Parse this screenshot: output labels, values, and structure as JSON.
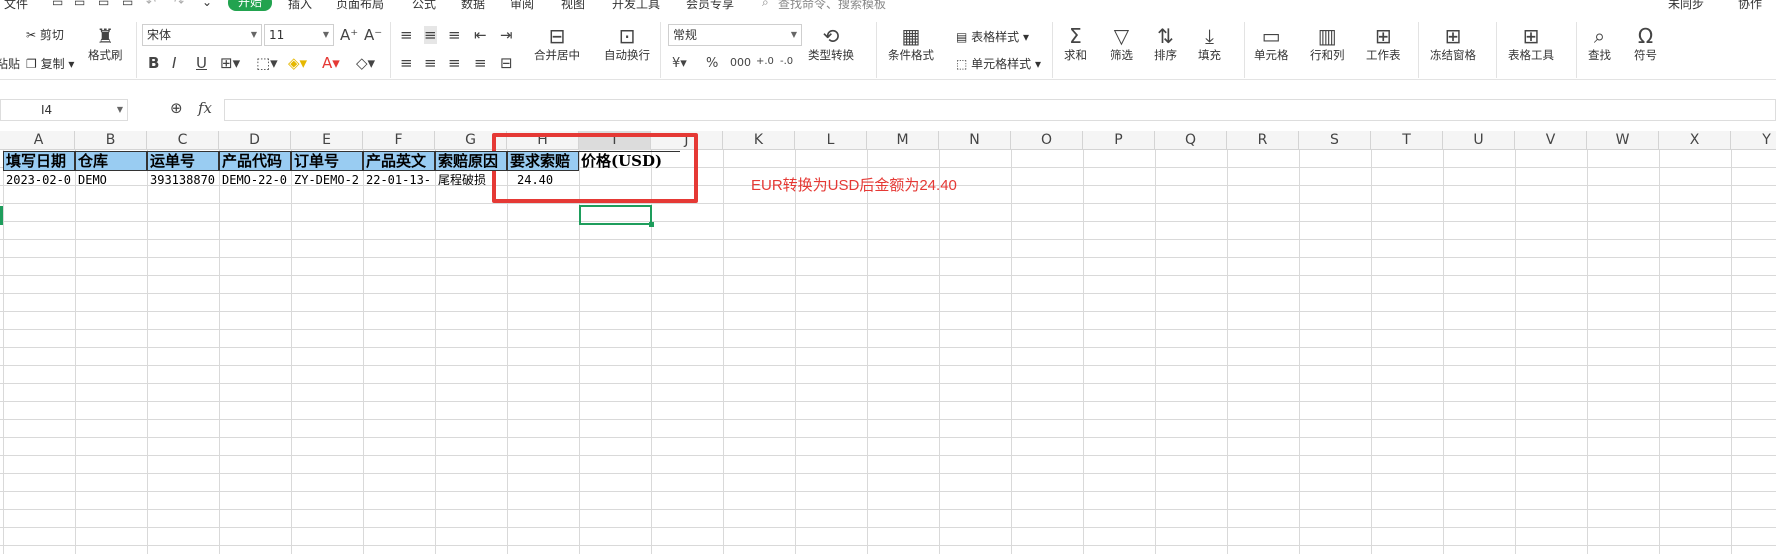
{
  "menubar": {
    "items": [
      "文件",
      "开始",
      "插入",
      "页面布局",
      "公式",
      "数据",
      "审阅",
      "视图",
      "开发工具",
      "会员专享"
    ],
    "search_placeholder": "查找命令、搜索模板",
    "right_items": [
      "未同步",
      "协作"
    ]
  },
  "ribbon": {
    "clipboard": {
      "cut": "剪切",
      "copy": "复制",
      "paste": "粘贴",
      "format_painter": "格式刷"
    },
    "font": {
      "name": "宋体",
      "size": "11"
    },
    "align": {
      "merge": "合并居中",
      "wrap": "自动换行"
    },
    "number": {
      "format": "常规",
      "convert": "类型转换"
    },
    "styles": {
      "conditional": "条件格式",
      "table_style": "表格样式",
      "cell_style": "单元格样式"
    },
    "editing": {
      "sum": "求和",
      "filter": "筛选",
      "sort": "排序",
      "fill": "填充"
    },
    "cells": {
      "cell": "单元格",
      "row_col": "行和列",
      "sheet": "工作表",
      "freeze": "冻结窗格",
      "table_tools": "表格工具",
      "find": "查找",
      "symbol": "符号"
    }
  },
  "formula_bar": {
    "name_box": "I4",
    "formula": ""
  },
  "columns": [
    "A",
    "B",
    "C",
    "D",
    "E",
    "F",
    "G",
    "H",
    "I",
    "J",
    "K",
    "L",
    "M",
    "N",
    "O",
    "P",
    "Q",
    "R",
    "S",
    "T",
    "U",
    "V",
    "W",
    "X",
    "Y"
  ],
  "selected_column": "I",
  "header_row": [
    "填写日期",
    "仓库",
    "运单号",
    "产品代码",
    "订单号",
    "产品英文",
    "索赔原因",
    "要求索赔",
    "价格(USD)"
  ],
  "data_row": [
    "2023-02-0",
    "DEMO",
    "393138870",
    "DEMO-22-0",
    "ZY-DEMO-2",
    "22-01-13-",
    "尾程破损",
    "24.40",
    ""
  ],
  "annotation": "EUR转换为USD后金额为24.40",
  "colors": {
    "header_fill": "#99ccf2",
    "annotation": "#e53935",
    "selection": "#1e9d5c",
    "active_tab": "#22a34f"
  }
}
